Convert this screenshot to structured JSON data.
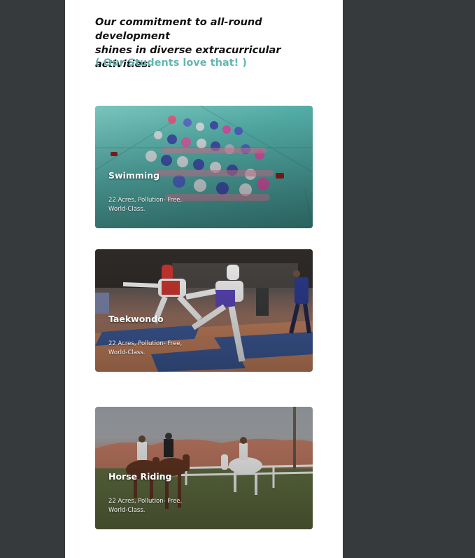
{
  "intro": {
    "line1": "Our commitment to all-round development",
    "line2": "shines in diverse extracurricular activities."
  },
  "tagline": "( Our Students love that! )",
  "colors": {
    "background": "#363a3c",
    "panel": "#ffffff",
    "accent": "#63b6b1"
  },
  "activities": [
    {
      "title": "Swimming",
      "desc_line1": "22 Acres, Pollution- Free,",
      "desc_line2": "World-Class."
    },
    {
      "title": "Taekwondo",
      "desc_line1": "22 Acres, Pollution- Free,",
      "desc_line2": "World-Class."
    },
    {
      "title": "Horse Riding",
      "desc_line1": "22 Acres, Pollution- Free,",
      "desc_line2": "World-Class."
    }
  ]
}
